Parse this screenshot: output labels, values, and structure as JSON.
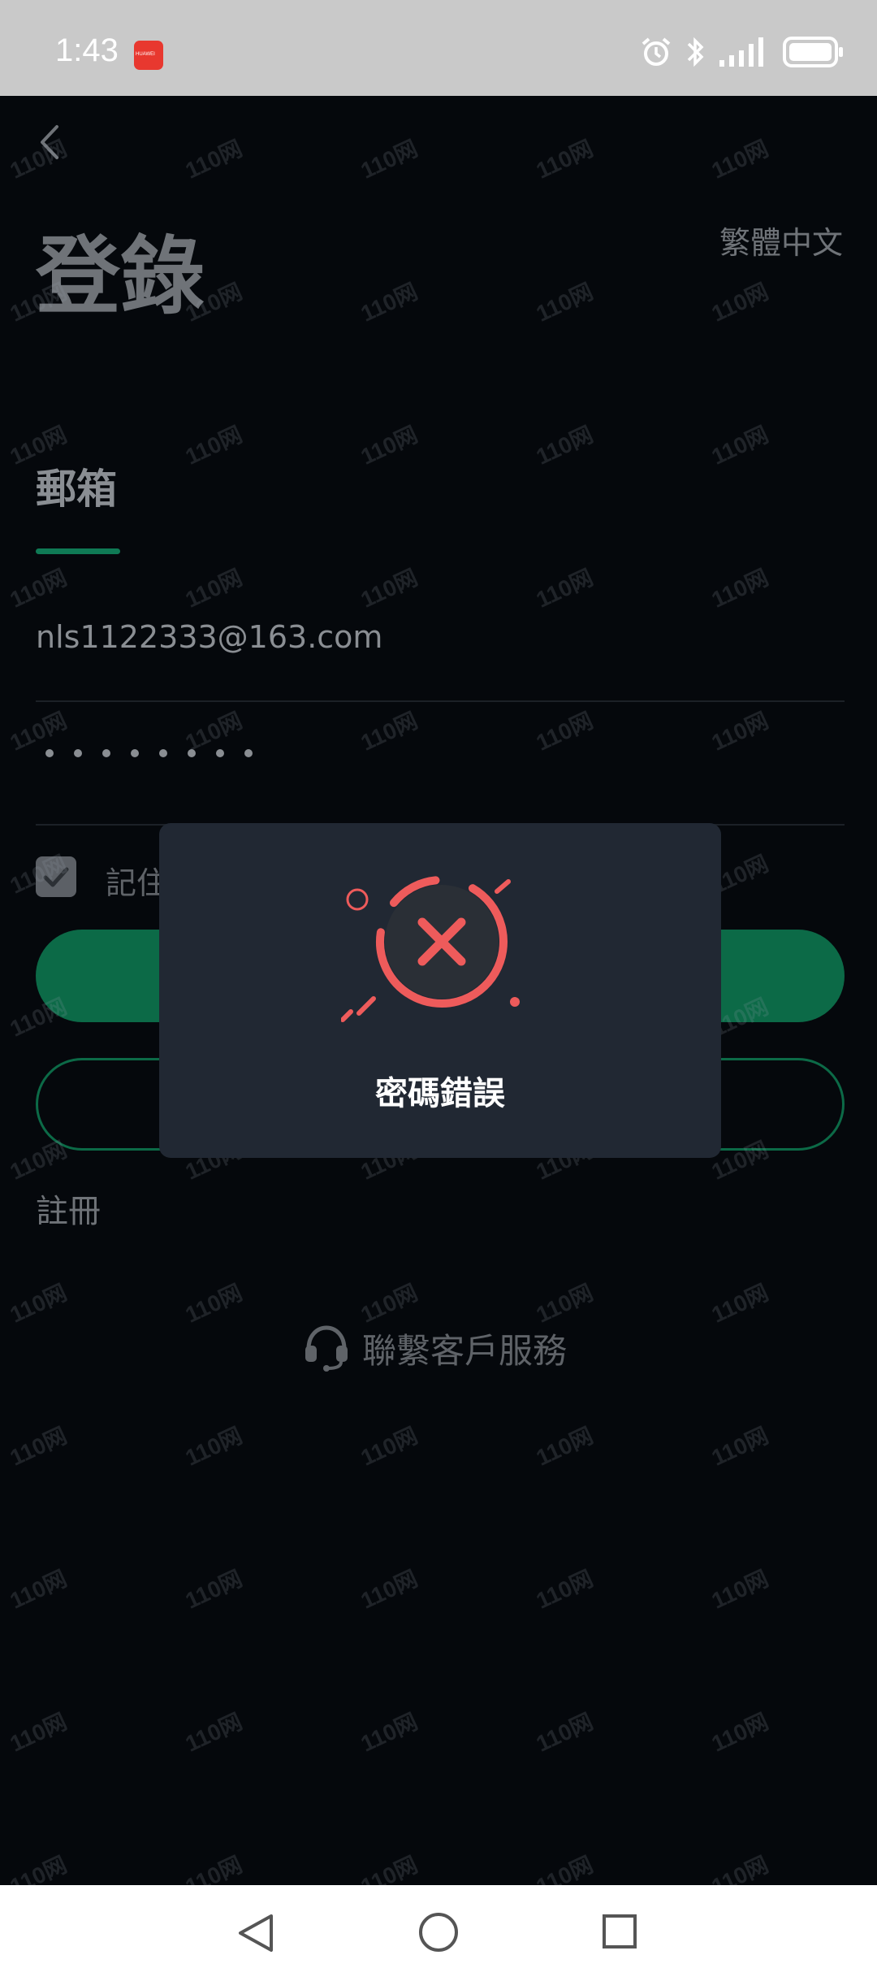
{
  "status_bar": {
    "time": "1:43",
    "app_badge_text": "HUAWEI",
    "icons": [
      "alarm-icon",
      "bluetooth-icon",
      "signal-icon",
      "battery-icon"
    ]
  },
  "header": {
    "title": "登錄",
    "language": "繁體中文"
  },
  "form": {
    "tab_label": "郵箱",
    "email_value": "nls1122333@163.com",
    "password_dot_count": 8,
    "remember_label": "記住",
    "register_label": "註冊"
  },
  "support": {
    "label": "聯繫客戶服務"
  },
  "dialog": {
    "message": "密碼錯誤",
    "icon": "error-x-icon"
  },
  "watermark": {
    "text": "110网"
  },
  "colors": {
    "accent": "#0c6a47",
    "error": "#ee5b5b",
    "dialog_bg": "#212833",
    "screen_bg": "#05080c"
  }
}
